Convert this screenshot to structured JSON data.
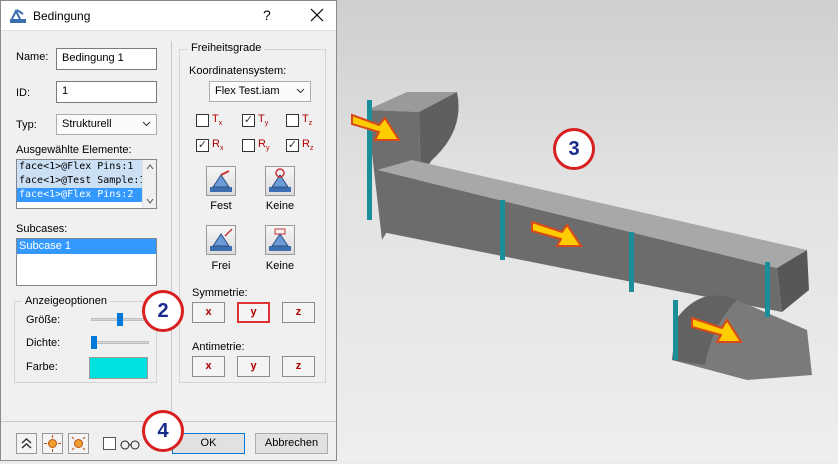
{
  "dialog": {
    "title": "Bedingung",
    "help": "?",
    "name_label": "Name:",
    "name_value": "Bedingung 1",
    "id_label": "ID:",
    "id_value": "1",
    "typ_label": "Typ:",
    "typ_value": "Strukturell",
    "selected_label": "Ausgewählte Elemente:",
    "selected_items": [
      "face<1>@Flex Pins:1",
      "face<1>@Test Sample:1",
      "face<1>@Flex Pins:2"
    ],
    "subcases_label": "Subcases:",
    "subcases": [
      "Subcase 1"
    ],
    "display": {
      "title": "Anzeigeoptionen",
      "size_label": "Größe:",
      "density_label": "Dichte:",
      "color_label": "Farbe:",
      "color": "#00e0e0"
    },
    "dof": {
      "title": "Freiheitsgrade",
      "coord_label": "Koordinatensystem:",
      "coord_value": "Flex Test.iam",
      "checks": [
        {
          "base": "T",
          "sub": "x",
          "checked": false
        },
        {
          "base": "T",
          "sub": "y",
          "checked": true
        },
        {
          "base": "T",
          "sub": "z",
          "checked": false
        },
        {
          "base": "R",
          "sub": "x",
          "checked": true
        },
        {
          "base": "R",
          "sub": "y",
          "checked": false
        },
        {
          "base": "R",
          "sub": "z",
          "checked": true
        }
      ],
      "fixed_label": "Fest",
      "none_label_1": "Keine",
      "free_label": "Frei",
      "none_label_2": "Keine",
      "symmetry_label": "Symmetrie:",
      "antisymmetry_label": "Antimetrie:",
      "axes": [
        "x",
        "y",
        "z"
      ]
    },
    "ok": "OK",
    "cancel": "Abbrechen"
  },
  "callouts": [
    "2",
    "3",
    "4"
  ]
}
